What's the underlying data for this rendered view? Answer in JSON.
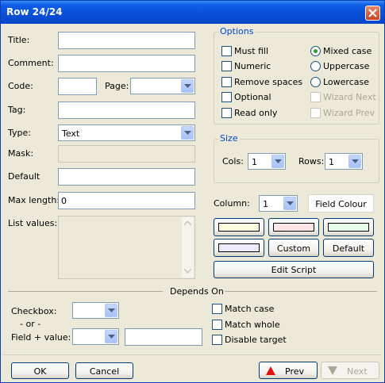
{
  "window": {
    "title": "Row 24/24"
  },
  "fields": {
    "title": {
      "label": "Title:",
      "value": ""
    },
    "comment": {
      "label": "Comment:",
      "value": ""
    },
    "code": {
      "label": "Code:",
      "value": ""
    },
    "page": {
      "label": "Page:",
      "value": ""
    },
    "tag": {
      "label": "Tag:",
      "value": ""
    },
    "type": {
      "label": "Type:",
      "value": "Text"
    },
    "mask": {
      "label": "Mask:",
      "value": ""
    },
    "default": {
      "label": "Default",
      "value": ""
    },
    "max_length": {
      "label": "Max length:",
      "value": "0"
    },
    "list_values": {
      "label": "List values:",
      "value": ""
    }
  },
  "options": {
    "title": "Options",
    "checkboxes": [
      {
        "label": "Must fill",
        "checked": false,
        "enabled": true
      },
      {
        "label": "Numeric",
        "checked": false,
        "enabled": true
      },
      {
        "label": "Remove spaces",
        "checked": false,
        "enabled": true
      },
      {
        "label": "Optional",
        "checked": false,
        "enabled": true
      },
      {
        "label": "Read only",
        "checked": false,
        "enabled": true
      }
    ],
    "case_radios": [
      {
        "label": "Mixed case",
        "selected": true
      },
      {
        "label": "Uppercase",
        "selected": false
      },
      {
        "label": "Lowercase",
        "selected": false
      }
    ],
    "wizard": [
      {
        "label": "Wizard Next",
        "checked": false,
        "enabled": false
      },
      {
        "label": "Wizard Prev",
        "checked": false,
        "enabled": false
      }
    ]
  },
  "size": {
    "title": "Size",
    "cols_label": "Cols:",
    "cols_value": "1",
    "rows_label": "Rows:",
    "rows_value": "1"
  },
  "column": {
    "label": "Column:",
    "value": "1",
    "field_colour_label": "Field Colour"
  },
  "colours": {
    "swatch1": "#ffffe0",
    "swatch2": "#ffe6e6",
    "swatch3": "#e8ffe8",
    "swatch4": "#ecebff",
    "custom_label": "Custom",
    "default_label": "Default"
  },
  "edit_script_label": "Edit Script",
  "depends_on": {
    "title": "Depends On",
    "checkbox_label": "Checkbox:",
    "or_label": "- or -",
    "field_value_label": "Field + value:",
    "checkbox_value": "",
    "field_value": "",
    "value_text": "",
    "match_case": "Match case",
    "match_whole": "Match whole",
    "disable_target": "Disable target"
  },
  "buttons": {
    "ok": "OK",
    "cancel": "Cancel",
    "prev": "Prev",
    "next": "Next"
  }
}
